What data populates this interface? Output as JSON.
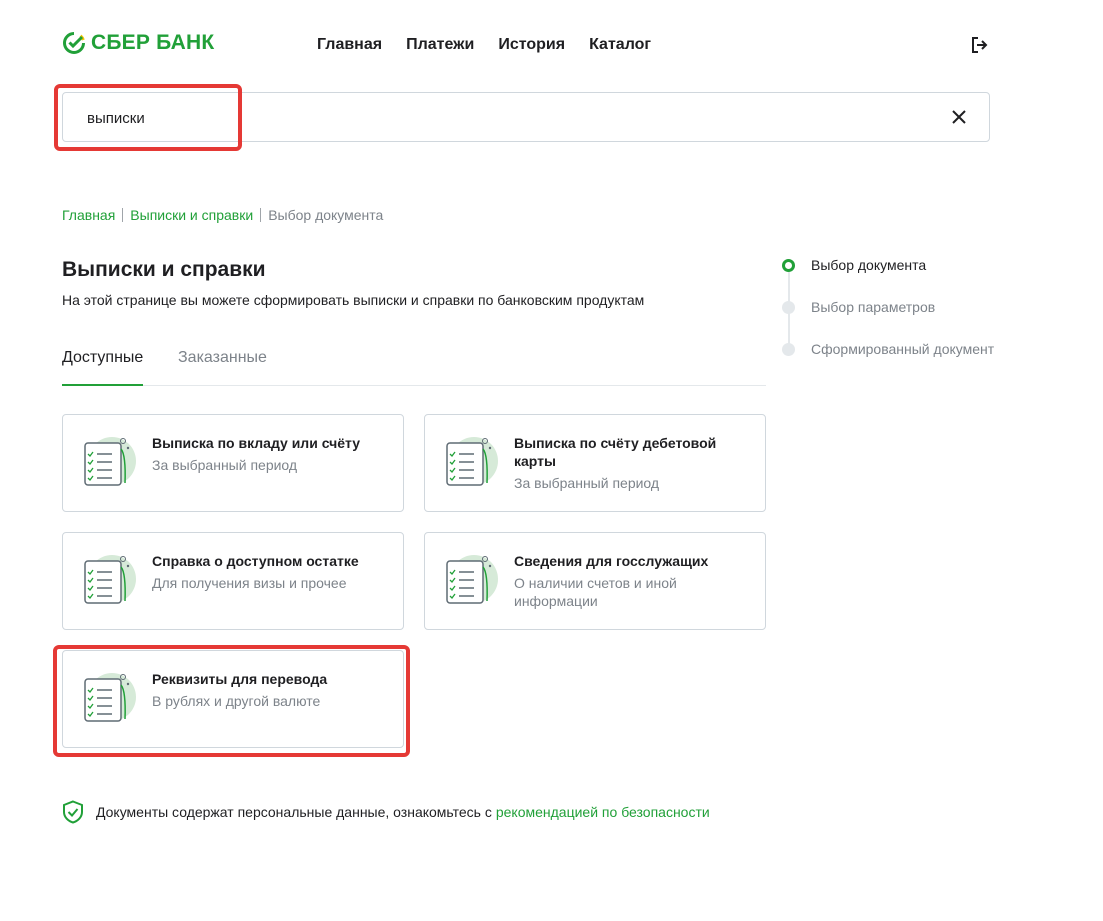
{
  "brand": {
    "name": "СБЕР БАНК",
    "green": "#21a038"
  },
  "nav": {
    "items": [
      {
        "label": "Главная"
      },
      {
        "label": "Платежи"
      },
      {
        "label": "История"
      },
      {
        "label": "Каталог"
      }
    ],
    "logout_icon": "logout-icon"
  },
  "search": {
    "value": "выписки",
    "clear_icon": "close-icon"
  },
  "breadcrumb": {
    "items": [
      "Главная",
      "Выписки и справки"
    ],
    "current": "Выбор документа"
  },
  "page": {
    "title": "Выписки и справки",
    "subtitle": "На этой странице вы можете сформировать выписки и справки по банковским продуктам"
  },
  "tabs": [
    {
      "label": "Доступные",
      "active": true
    },
    {
      "label": "Заказанные",
      "active": false
    }
  ],
  "cards": [
    {
      "title": "Выписка по вкладу или счёту",
      "description": "За выбранный период",
      "icon": "document-icon"
    },
    {
      "title": "Выписка по счёту дебетовой карты",
      "description": "За выбранный период",
      "icon": "document-icon"
    },
    {
      "title": "Справка о доступном остатке",
      "description": "Для получения визы и прочее",
      "icon": "document-icon"
    },
    {
      "title": "Сведения для госслужащих",
      "description": "О наличии счетов и иной информации",
      "icon": "document-icon"
    },
    {
      "title": "Реквизиты для перевода",
      "description": "В рублях и другой валюте",
      "icon": "document-icon"
    }
  ],
  "stepper": {
    "steps": [
      {
        "label": "Выбор документа",
        "active": true
      },
      {
        "label": "Выбор параметров",
        "active": false
      },
      {
        "label": "Сформированный документ",
        "active": false
      }
    ]
  },
  "footer_note": {
    "text": "Документы содержат персональные данные, ознакомьтесь с",
    "link": "рекомендацией по безопасности",
    "icon": "shield-check-icon"
  },
  "highlight_color": "#e53935"
}
